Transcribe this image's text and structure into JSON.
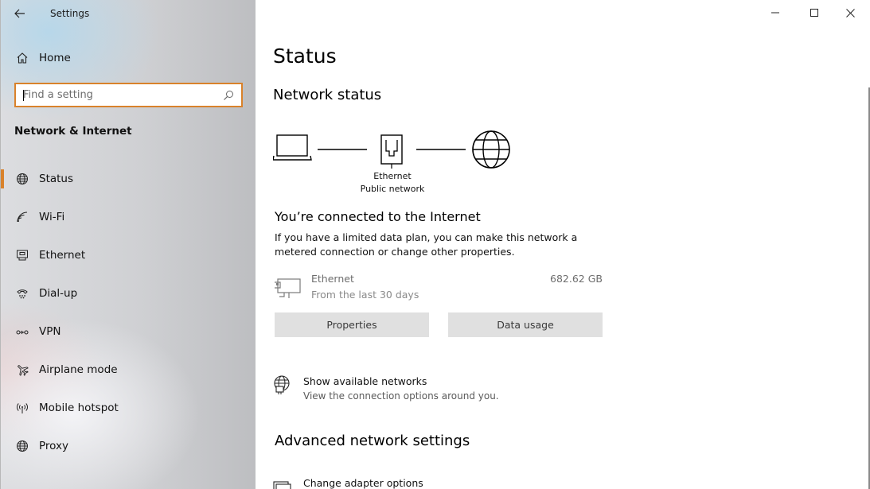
{
  "window": {
    "title": "Settings"
  },
  "sidebar": {
    "home_label": "Home",
    "search_placeholder": "Find a setting",
    "section_title": "Network & Internet",
    "items": [
      {
        "label": "Status",
        "icon": "globe-icon",
        "active": true
      },
      {
        "label": "Wi-Fi",
        "icon": "wifi-icon"
      },
      {
        "label": "Ethernet",
        "icon": "ethernet-icon"
      },
      {
        "label": "Dial-up",
        "icon": "dialup-icon"
      },
      {
        "label": "VPN",
        "icon": "vpn-icon"
      },
      {
        "label": "Airplane mode",
        "icon": "airplane-icon"
      },
      {
        "label": "Mobile hotspot",
        "icon": "hotspot-icon"
      },
      {
        "label": "Proxy",
        "icon": "globe-icon"
      }
    ]
  },
  "main": {
    "page_title": "Status",
    "network_status_heading": "Network status",
    "diagram": {
      "adapter_name": "Ethernet",
      "network_type": "Public network"
    },
    "connected_text": "You’re connected to the Internet",
    "description": "If you have a limited data plan, you can make this network a metered connection or change other properties.",
    "usage": {
      "name": "Ethernet",
      "period": "From the last 30 days",
      "amount": "682.62 GB"
    },
    "buttons": {
      "properties": "Properties",
      "data_usage": "Data usage"
    },
    "show_networks": {
      "title": "Show available networks",
      "subtitle": "View the connection options around you."
    },
    "advanced_heading": "Advanced network settings",
    "change_adapter": {
      "title": "Change adapter options"
    }
  },
  "colors": {
    "accent": "#d9822b",
    "button_bg": "#e0e0e0"
  }
}
